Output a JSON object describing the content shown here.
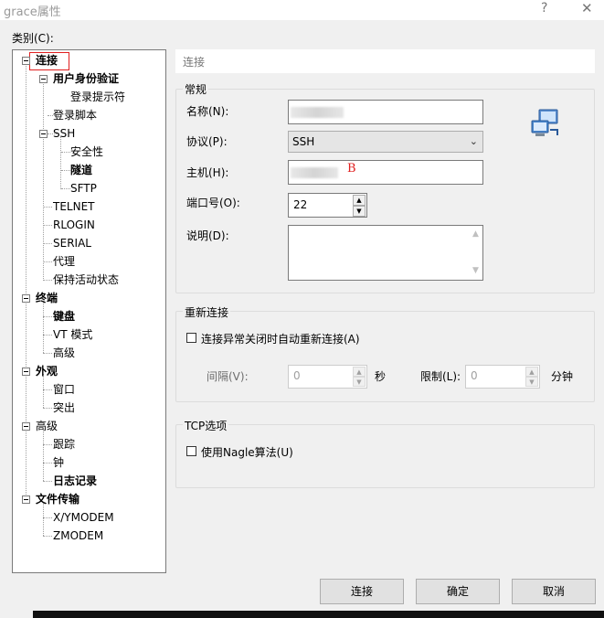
{
  "window": {
    "title": "grace属性",
    "help_glyph": "?",
    "close_glyph": "✕"
  },
  "category_label": "类别(C):",
  "tree": {
    "connection": "连接",
    "auth": "用户身份验证",
    "login_prompt": "登录提示符",
    "login_script": "登录脚本",
    "ssh": "SSH",
    "security": "安全性",
    "tunnel": "隧道",
    "sftp": "SFTP",
    "telnet": "TELNET",
    "rlogin": "RLOGIN",
    "serial": "SERIAL",
    "proxy": "代理",
    "keepalive": "保持活动状态",
    "terminal": "终端",
    "keyboard": "键盘",
    "vt_mode": "VT 模式",
    "terminal_advanced": "高级",
    "appearance": "外观",
    "window": "窗口",
    "highlight": "突出",
    "advanced": "高级",
    "trace": "跟踪",
    "bell": "钟",
    "logging": "日志记录",
    "file_transfer": "文件传输",
    "xymodem": "X/YMODEM",
    "zmodem": "ZMODEM"
  },
  "header": "连接",
  "general": {
    "title": "常规",
    "name_label": "名称(N):",
    "name_value": "",
    "protocol_label": "协议(P):",
    "protocol_value": "SSH",
    "host_label": "主机(H):",
    "host_annotation": "B",
    "port_label": "端口号(O):",
    "port_value": "22",
    "desc_label": "说明(D):"
  },
  "reconnect": {
    "title": "重新连接",
    "auto_label": "连接异常关闭时自动重新连接(A)",
    "interval_label": "间隔(V):",
    "interval_value": "0",
    "interval_unit": "秒",
    "limit_label": "限制(L):",
    "limit_value": "0",
    "limit_unit": "分钟"
  },
  "tcp": {
    "title": "TCP选项",
    "nagle_label": "使用Nagle算法(U)"
  },
  "buttons": {
    "connect": "连接",
    "ok": "确定",
    "cancel": "取消"
  }
}
